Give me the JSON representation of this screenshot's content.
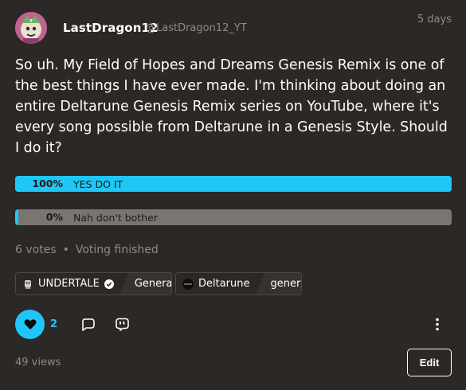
{
  "post": {
    "author": {
      "display_name": "LastDragon12",
      "handle": "@LastDragon12_YT",
      "avatar_icon": "avatar-image"
    },
    "timestamp": "5 days",
    "body": "So uh. My Field of Hopes and Dreams Genesis Remix is one of the best things I have ever made. I'm thinking about doing an entire Deltarune Genesis Remix series on YouTube, where it's every song possible from Deltarune in a Genesis Style. Should I do it?"
  },
  "poll": {
    "options": [
      {
        "percent_label": "100%",
        "label": "YES DO IT",
        "fraction": 1.0
      },
      {
        "percent_label": "0%",
        "label": "Nah don't bother",
        "fraction": 0.0
      }
    ],
    "votes": "6 votes",
    "separator": "•",
    "status": "Voting finished"
  },
  "tags": [
    {
      "name": "UNDERTALE",
      "sub": "General",
      "verified": true,
      "icon": "undertale-icon"
    },
    {
      "name": "Deltarune",
      "sub": "general",
      "verified": false,
      "icon": "deltarune-icon"
    }
  ],
  "actions": {
    "like_count": "2",
    "like_icon": "heart-icon",
    "reply_icon": "reply-icon",
    "quote_icon": "quote-icon",
    "more_icon": "more-icon"
  },
  "footer": {
    "views": "49 views",
    "edit_label": "Edit"
  },
  "colors": {
    "background": "#2b2826",
    "accent": "#20c6f6",
    "poll_track": "#7a7571",
    "muted_text": "#8f8a86"
  }
}
